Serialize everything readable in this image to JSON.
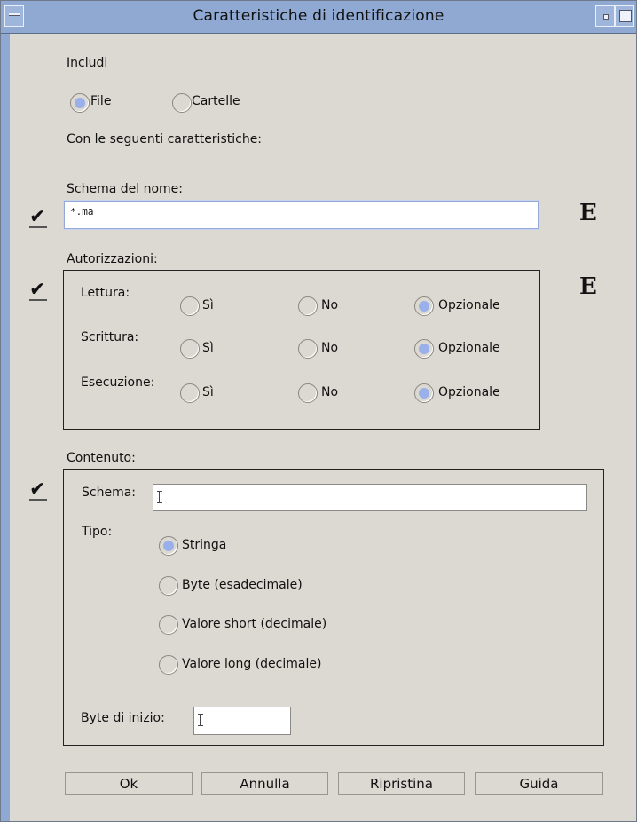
{
  "window": {
    "title": "Caratteristiche di identificazione",
    "menu_icon": "window-menu-icon",
    "minimize_icon": "window-minimize-icon",
    "maximize_icon": "window-maximize-icon"
  },
  "include": {
    "label": "Includi",
    "options": [
      {
        "label": "File",
        "selected": true
      },
      {
        "label": "Cartelle",
        "selected": false
      }
    ]
  },
  "characteristics_label": "Con le seguenti caratteristiche:",
  "name_pattern": {
    "label": "Schema del nome:",
    "checked": true,
    "value": "*.ma",
    "marker": "E"
  },
  "permissions": {
    "label": "Autorizzazioni:",
    "checked": true,
    "marker": "E",
    "rows": [
      {
        "label": "Lettura:",
        "options": [
          "Sì",
          "No",
          "Opzionale"
        ],
        "selected": "Opzionale"
      },
      {
        "label": "Scrittura:",
        "options": [
          "Sì",
          "No",
          "Opzionale"
        ],
        "selected": "Opzionale"
      },
      {
        "label": "Esecuzione:",
        "options": [
          "Sì",
          "No",
          "Opzionale"
        ],
        "selected": "Opzionale"
      }
    ]
  },
  "content": {
    "label": "Contenuto:",
    "checked": true,
    "pattern_label": "Schema:",
    "pattern_value": "",
    "type_label": "Tipo:",
    "types": [
      {
        "label": "Stringa",
        "selected": true
      },
      {
        "label": "Byte (esadecimale)",
        "selected": false
      },
      {
        "label": "Valore short (decimale)",
        "selected": false
      },
      {
        "label": "Valore long (decimale)",
        "selected": false
      }
    ],
    "start_byte_label": "Byte di inizio:",
    "start_byte_value": ""
  },
  "buttons": {
    "ok": "Ok",
    "cancel": "Annulla",
    "reset": "Ripristina",
    "help": "Guida"
  },
  "colors": {
    "titlebar": "#8fa9d2",
    "background": "#dcd8d2",
    "radio_selected": "#9ab0ea"
  }
}
